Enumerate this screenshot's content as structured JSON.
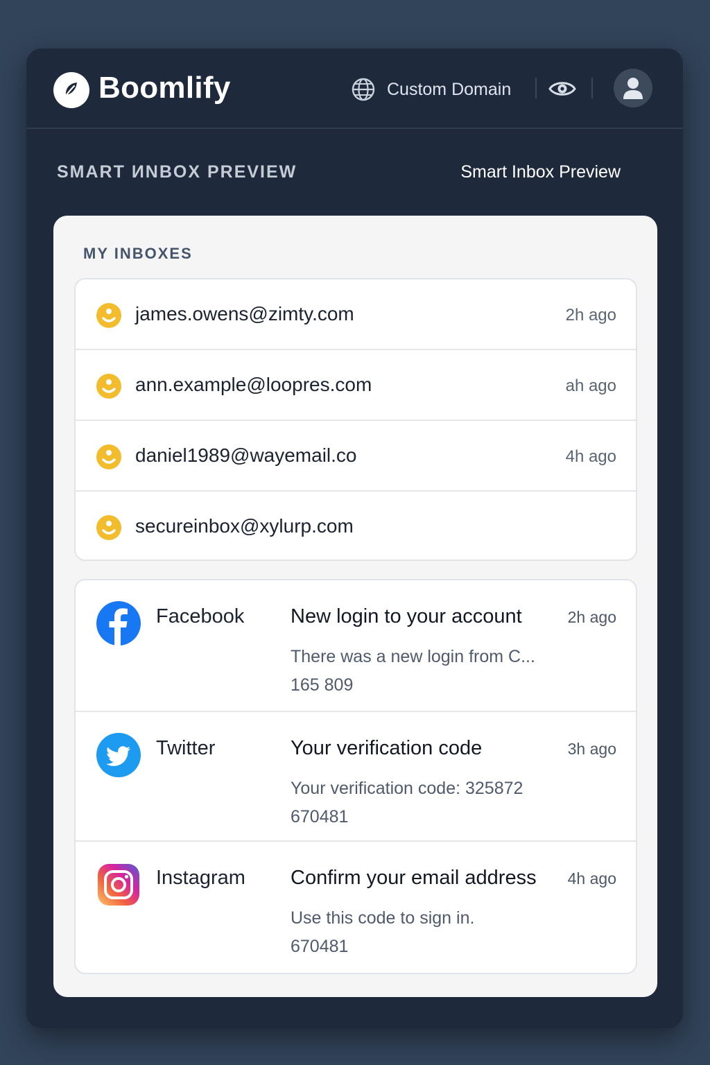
{
  "app": {
    "brand": "Boomlify",
    "custom_domain_label": "Custom Domain",
    "icons": {
      "logo": "leaf-logo-icon",
      "domain": "globe-icon",
      "preview": "eye-icon",
      "user": "user-avatar-icon"
    }
  },
  "section": {
    "title": "SMART ИNBOX PREVIEW",
    "subtitle": "Smart Inbox Preview"
  },
  "inboxes": {
    "heading": "MY INBOXES",
    "items": [
      {
        "email": "james.owens@zimty.com",
        "time": "2h ago",
        "icon": "status-face-icon"
      },
      {
        "email": "ann.example@loopres.com",
        "time": "ah ago",
        "icon": "status-face-icon"
      },
      {
        "email": "daniel1989@wayemail.co",
        "time": "4h ago",
        "icon": "status-face-icon"
      },
      {
        "email": "secureinbox@xylurp.com",
        "time": "",
        "icon": "status-face-icon"
      }
    ]
  },
  "messages": [
    {
      "sender": "Facebook",
      "icon": "facebook-icon",
      "subject": "New login to your account",
      "time": "2h ago",
      "preview": "There was a new login from C...",
      "code": "165 809"
    },
    {
      "sender": "Twitter",
      "icon": "twitter-icon",
      "subject": "Your verification code",
      "time": "3h ago",
      "preview": "Your verification code: 325872",
      "code": "670481"
    },
    {
      "sender": "Instagram",
      "icon": "instagram-icon",
      "subject": "Confirm your email address",
      "time": "4h ago",
      "preview": "Use this code to sign in.",
      "code": "670481"
    }
  ],
  "colors": {
    "page_bg": "#32445a",
    "window_bg": "#1e2a3b",
    "panel_bg": "#f5f5f5",
    "status_yellow": "#f2bc2c",
    "facebook_blue": "#1877f2",
    "twitter_blue": "#1d9bf0"
  }
}
